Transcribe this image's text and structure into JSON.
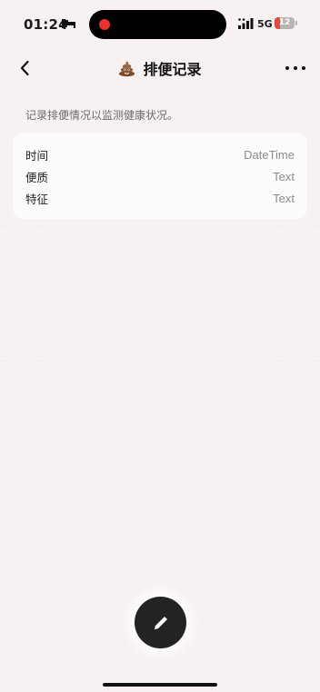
{
  "status_bar": {
    "time": "01:24",
    "network": "5G",
    "battery_level": "12",
    "battery_color": "#e5473a",
    "recording_color": "#e8322c",
    "icons": [
      "bed-icon",
      "signal-icon",
      "battery-icon"
    ]
  },
  "nav": {
    "title": "排便记录",
    "title_icon": "poop-emoji-icon",
    "back_icon": "chevron-left-icon",
    "more_icon": "more-horizontal-icon"
  },
  "description": "记录排便情况以监测健康状况。",
  "fields": [
    {
      "label": "时间",
      "type": "DateTime"
    },
    {
      "label": "便质",
      "type": "Text"
    },
    {
      "label": "特征",
      "type": "Text"
    }
  ],
  "fab": {
    "icon": "pencil-icon",
    "background": "#232323"
  }
}
